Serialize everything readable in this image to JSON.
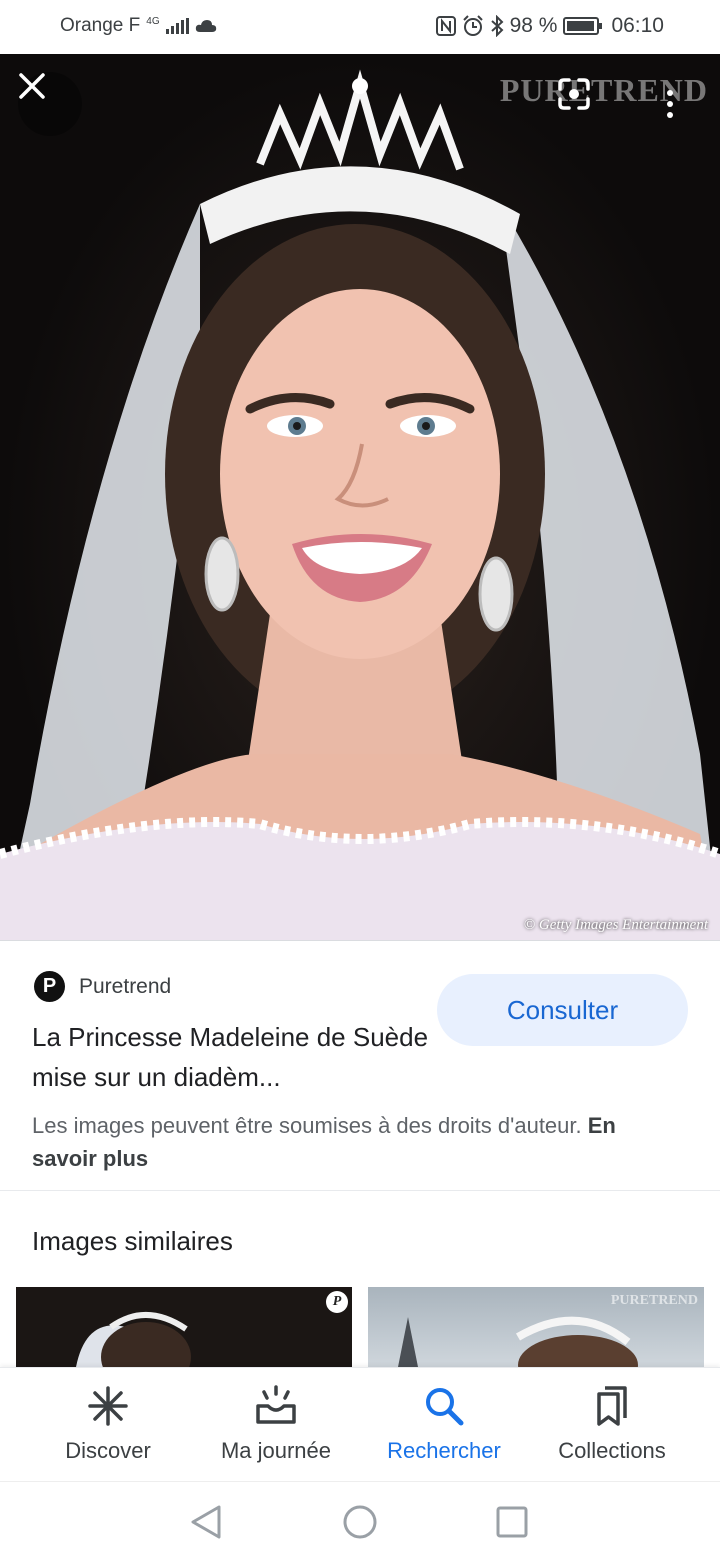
{
  "status_bar": {
    "carrier": "Orange F",
    "network": "4G",
    "battery": "98 %",
    "time": "06:10"
  },
  "image_viewer": {
    "watermark": "PURETREND",
    "credit": "© Getty Images Entertainment",
    "close_icon": "close-icon",
    "lens_icon": "google-lens-icon",
    "more_icon": "more-vert-icon"
  },
  "result": {
    "source_logo_letter": "P",
    "source_name": "Puretrend",
    "title": "La Princesse Madeleine de Suède mise sur un diadèm...",
    "consult_button": "Consulter",
    "copyright_text": "Les images peuvent être soumises à des droits d'auteur.",
    "learn_more": "En savoir plus"
  },
  "similar": {
    "heading": "Images similaires",
    "thumb1_badge": "P",
    "thumb2_watermark": "PURETREND"
  },
  "bottom_nav": {
    "items": [
      {
        "label": "Discover",
        "icon": "asterisk-icon"
      },
      {
        "label": "Ma journée",
        "icon": "sunrise-icon"
      },
      {
        "label": "Rechercher",
        "icon": "search-icon",
        "active": true
      },
      {
        "label": "Collections",
        "icon": "bookmarks-icon"
      }
    ]
  },
  "colors": {
    "accent": "#1a73e8",
    "consult_bg": "#e8f0fe",
    "consult_text": "#1967d2"
  }
}
